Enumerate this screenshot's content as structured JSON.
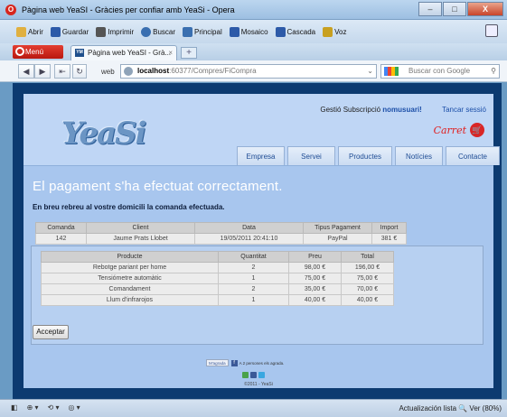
{
  "window": {
    "title": "Pàgina web YeaSI - Gràcies per confiar amb YeaSi - Opera",
    "minimize": "–",
    "maximize": "□",
    "close": "X"
  },
  "menubar": {
    "items": [
      {
        "label": "Abrir",
        "icon": "folder-icon",
        "color": "#e0b040"
      },
      {
        "label": "Guardar",
        "icon": "save-icon",
        "color": "#2d5aa8"
      },
      {
        "label": "Imprimir",
        "icon": "print-icon",
        "color": "#555555"
      },
      {
        "label": "Buscar",
        "icon": "search-icon",
        "color": "#3a6fb0"
      },
      {
        "label": "Principal",
        "icon": "home-icon",
        "color": "#3a6fb0"
      },
      {
        "label": "Mosaico",
        "icon": "tile-icon",
        "color": "#2d5aa8"
      },
      {
        "label": "Cascada",
        "icon": "cascade-icon",
        "color": "#2d5aa8"
      },
      {
        "label": "Voz",
        "icon": "voice-icon",
        "color": "#c8a020"
      }
    ]
  },
  "tabs": {
    "menu_label": "Menú",
    "active_tab": "Pàgina web YeaSI - Grà...",
    "favicon_text": "YM",
    "close": "×",
    "new_tab": "+"
  },
  "address": {
    "back": "◀",
    "forward": "▶",
    "rewind": "⇤",
    "reload": "↻",
    "home": "⌂",
    "web_label": "web",
    "url_host": "localhost",
    "url_path": ":60377/Compres/FiCompra",
    "dropdown": "⌄",
    "search_placeholder": "Buscar con Google",
    "search_icon": "⚲"
  },
  "site": {
    "logo": "YeaSi",
    "greeting": "Gestió Subscripció",
    "username": "nomusuari!",
    "logout": "Tancar sessió",
    "cart_label": "Carret",
    "cart_icon": "🛒",
    "nav": [
      "Empresa",
      "Servei",
      "Productes",
      "Notícies",
      "Contacte"
    ],
    "success_title": "El pagament s'ha efectuat correctament.",
    "success_sub": "En breu rebreu al vostre domicili la comanda efectuada.",
    "order": {
      "headers": [
        "Comanda",
        "Client",
        "Data",
        "Tipus Pagament",
        "Import"
      ],
      "row": [
        "142",
        "Jaume Prats Llobet",
        "19/05/2011 20:41:10",
        "PayPal",
        "381 €"
      ]
    },
    "products": {
      "headers": [
        "Producte",
        "Quantitat",
        "Preu",
        "Total"
      ],
      "rows": [
        [
          "Rebotge pariant per home",
          "2",
          "98,00 €",
          "196,00 €"
        ],
        [
          "Tensiómetre automàtic",
          "1",
          "75,00 €",
          "75,00 €"
        ],
        [
          "Comandament",
          "2",
          "35,00 €",
          "70,00 €"
        ],
        [
          "Llum d'infrarojos",
          "1",
          "40,00 €",
          "40,00 €"
        ]
      ]
    },
    "accept": "Acceptar",
    "like_btn": "M'agrada",
    "like_text": "A 2 persones els agrada.",
    "copyright": "©2011 - YeaSi"
  },
  "statusbar": {
    "left": [
      "◧",
      "⊕ ▾",
      "⟲ ▾",
      "◎ ▾"
    ],
    "right": "Actualización lista   🔍 Ver (80%)"
  }
}
